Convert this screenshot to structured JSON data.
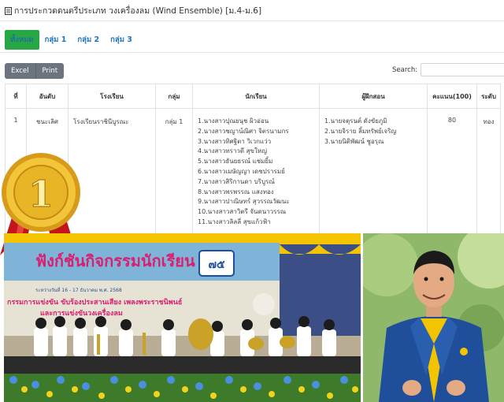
{
  "page": {
    "title": "การประกวดดนตรีประเภท วงเครื่องลม (Wind Ensemble) [ม.4-ม.6]"
  },
  "tabs": [
    {
      "label": "ทั้งหมด",
      "active": true
    },
    {
      "label": "กลุ่ม 1",
      "active": false
    },
    {
      "label": "กลุ่ม 2",
      "active": false
    },
    {
      "label": "กลุ่ม 3",
      "active": false
    }
  ],
  "toolbar": {
    "excel_label": "Excel",
    "print_label": "Print"
  },
  "search": {
    "label": "Search:",
    "value": ""
  },
  "table": {
    "headers": [
      "ที่",
      "อันดับ",
      "โรงเรียน",
      "กลุ่ม",
      "นักเรียน",
      "ผู้ฝึกสอน",
      "คะแนน(100)",
      "ระดับ"
    ],
    "rows": [
      {
        "no": "1",
        "rank": "ชนะเลิศ",
        "school": "โรงเรียนราชินีบูรณะ",
        "group": "กลุ่ม 1",
        "students": [
          "1.นางสาวปุณยนุช ผิวอ่อน",
          "2.นางสาวชญาน์ณิศา จิตรนามกร",
          "3.นางสาวทิศฐิตา วิเวกแว่ว",
          "4.นางสาวทราวดี สุขใหญ่",
          "5.นางสาวธันยธรณ์ แช่มยิ้ม",
          "6.นางสาวเมษัญญา เดชปรารมย์",
          "7.นางสาวสิริกานดา บริบูรณ์",
          "8.นางสาวพรพรรณ แสงทอง",
          "9.นางสาวปาณิษทร์ สุวรรณวัฒนะ",
          "10.นางสาวสาวิตรี จันดนาวรรณ",
          "11.นางสาวลิลลี่ สุขแก้วฟ้า"
        ],
        "trainers": [
          "1.นายจตุรนต์ ดังขัยภูมิ",
          "2.นายจิราย ลิ้มทรัพย์เจริญ",
          "3.นายนิติพัฒน์ ชูอรุณ"
        ],
        "score": "80",
        "level": "ทอง"
      }
    ]
  },
  "overlay": {
    "medal_number": "1",
    "banner_title": "ฟังก์ชันกิจกรรมนักเรียน",
    "banner_line": "กรรมการแข่งขัน ขับร้องประสานเสียง เพลงพระราชนิพนธ์",
    "banner_line2": "และการแข่งขันวงเครื่องลม",
    "banner_date": "ระหว่างวันที่ 16 - 17 ธันวาคม พ.ศ. 2568",
    "banner_badge": "๗๕"
  },
  "colors": {
    "tab_active_bg": "#28a745",
    "link": "#1e73be",
    "button_gray": "#6c757d",
    "medal_gold": "#e7b526",
    "ribbon_red": "#c0161c",
    "suit_blue": "#1f4e9a",
    "shirt_yellow": "#f2c500"
  }
}
